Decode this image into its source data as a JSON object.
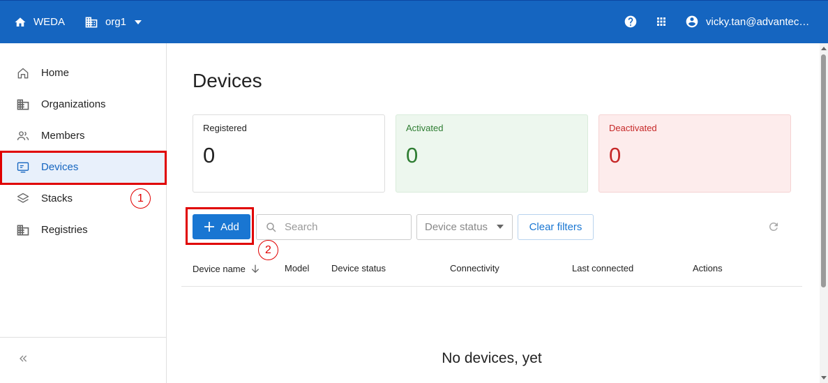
{
  "topbar": {
    "brand": "WEDA",
    "org": "org1",
    "user": "vicky.tan@advantech.com",
    "color": "#1565c0"
  },
  "sidebar": {
    "items": [
      {
        "label": "Home",
        "icon": "home-outline-icon"
      },
      {
        "label": "Organizations",
        "icon": "building-icon"
      },
      {
        "label": "Members",
        "icon": "people-icon"
      },
      {
        "label": "Devices",
        "icon": "device-icon",
        "active": true
      },
      {
        "label": "Stacks",
        "icon": "layers-icon"
      },
      {
        "label": "Registries",
        "icon": "building-icon"
      }
    ],
    "collapse_icon": "double-chevron-left-icon"
  },
  "annotations": {
    "step1": "1",
    "step2": "2",
    "color": "#e00000"
  },
  "main": {
    "title": "Devices",
    "cards": {
      "registered": {
        "label": "Registered",
        "value": "0"
      },
      "activated": {
        "label": "Activated",
        "value": "0"
      },
      "deactivated": {
        "label": "Deactivated",
        "value": "0"
      }
    },
    "toolbar": {
      "add_label": "Add",
      "search_placeholder": "Search",
      "status_placeholder": "Device status",
      "clear_label": "Clear filters"
    },
    "table": {
      "columns": [
        "Device name",
        "Model",
        "Device status",
        "Connectivity",
        "Last connected",
        "Actions"
      ],
      "empty_text": "No devices, yet"
    }
  }
}
